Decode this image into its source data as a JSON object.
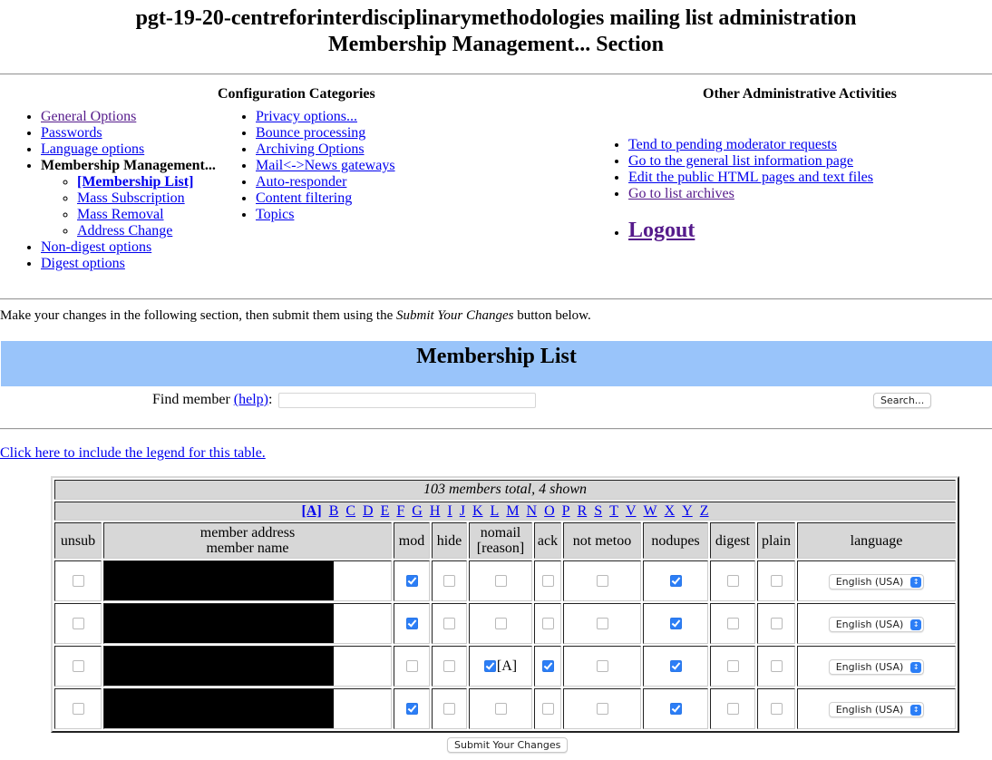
{
  "header": {
    "title": "pgt-19-20-centreforinterdisciplinarymethodologies mailing list administration",
    "subtitle": "Membership Management... Section"
  },
  "config_categories": {
    "heading": "Configuration Categories",
    "col1": [
      {
        "label": "General Options",
        "visited": true
      },
      {
        "label": "Passwords"
      },
      {
        "label": "Language options"
      },
      {
        "label": "Membership Management...",
        "current": true,
        "children": [
          {
            "label": "[Membership List]",
            "current": true
          },
          {
            "label": "Mass Subscription"
          },
          {
            "label": "Mass Removal"
          },
          {
            "label": "Address Change"
          }
        ]
      },
      {
        "label": "Non-digest options"
      },
      {
        "label": "Digest options"
      }
    ],
    "col2": [
      {
        "label": "Privacy options..."
      },
      {
        "label": "Bounce processing"
      },
      {
        "label": "Archiving Options"
      },
      {
        "label": "Mail<->News gateways"
      },
      {
        "label": "Auto-responder"
      },
      {
        "label": "Content filtering"
      },
      {
        "label": "Topics"
      }
    ]
  },
  "other_activities": {
    "heading": "Other Administrative Activities",
    "items": [
      {
        "label": "Tend to pending moderator requests"
      },
      {
        "label": "Go to the general list information page"
      },
      {
        "label": "Edit the public HTML pages and text files"
      },
      {
        "label": "Go to list archives",
        "visited": true
      }
    ],
    "logout": "Logout"
  },
  "intro": {
    "before": "Make your changes in the following section, then submit them using the ",
    "emphasis": "Submit Your Changes",
    "after": " button below."
  },
  "membership_list": {
    "title": "Membership List",
    "find_label": "Find member ",
    "help_link": "(help)",
    "find_colon": ":",
    "find_value": "",
    "search_button": "Search...",
    "legend_link": "Click here to include the legend for this table."
  },
  "table": {
    "summary": "103 members total, 4 shown",
    "letters": [
      "[A]",
      "B",
      "C",
      "D",
      "E",
      "F",
      "G",
      "H",
      "I",
      "J",
      "K",
      "L",
      "M",
      "N",
      "O",
      "P",
      "R",
      "S",
      "T",
      "V",
      "W",
      "X",
      "Y",
      "Z"
    ],
    "columns": {
      "unsub": "unsub",
      "address_line1": "member address",
      "address_line2": "member name",
      "mod": "mod",
      "hide": "hide",
      "nomail_line1": "nomail",
      "nomail_line2": "[reason]",
      "ack": "ack",
      "notmetoo": "not metoo",
      "nodupes": "nodupes",
      "digest": "digest",
      "plain": "plain",
      "language": "language"
    },
    "rows": [
      {
        "address": "[redacted]",
        "unsub": false,
        "mod": true,
        "hide": false,
        "nomail": false,
        "nomail_reason": "",
        "ack": false,
        "notmetoo": false,
        "nodupes": true,
        "digest": false,
        "plain": false,
        "language": "English (USA)"
      },
      {
        "address": "[redacted]",
        "unsub": false,
        "mod": true,
        "hide": false,
        "nomail": false,
        "nomail_reason": "",
        "ack": false,
        "notmetoo": false,
        "nodupes": true,
        "digest": false,
        "plain": false,
        "language": "English (USA)"
      },
      {
        "address": "[redacted]",
        "unsub": false,
        "mod": false,
        "hide": false,
        "nomail": true,
        "nomail_reason": "[A]",
        "ack": true,
        "notmetoo": false,
        "nodupes": true,
        "digest": false,
        "plain": false,
        "language": "English (USA)"
      },
      {
        "address": "[redacted]",
        "unsub": false,
        "mod": true,
        "hide": false,
        "nomail": false,
        "nomail_reason": "",
        "ack": false,
        "notmetoo": false,
        "nodupes": true,
        "digest": false,
        "plain": false,
        "language": "English (USA)"
      }
    ]
  },
  "submit_button": "Submit Your Changes",
  "colors": {
    "band": "#99c4fa",
    "link": "#0000ee",
    "visited": "#551a8b",
    "checkbox_on": "#2c7ef6"
  }
}
